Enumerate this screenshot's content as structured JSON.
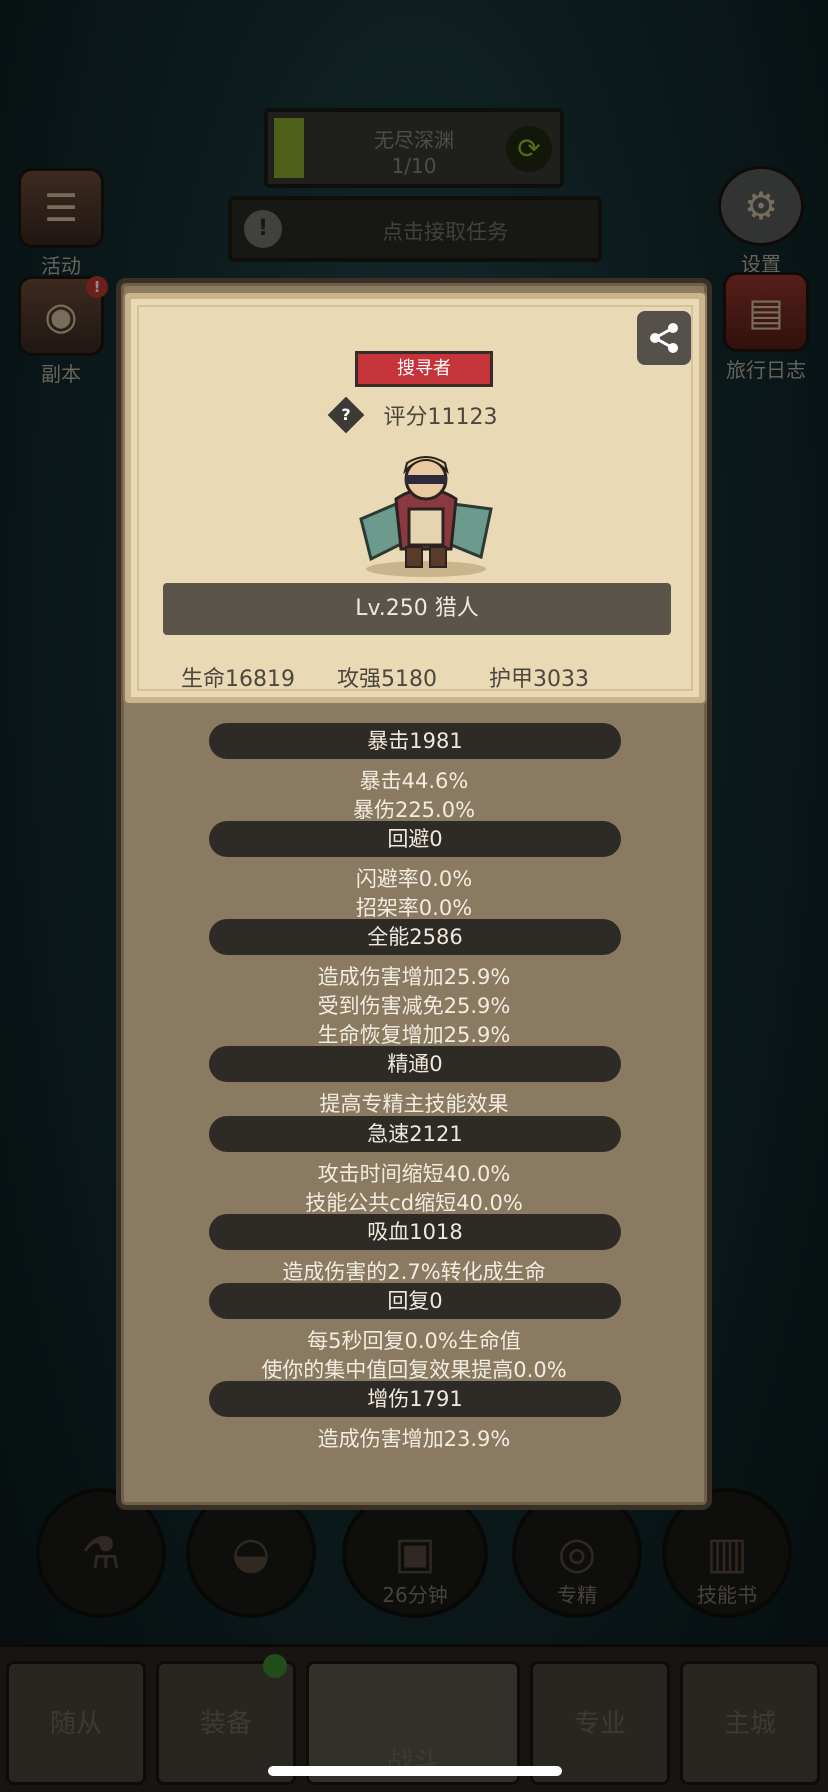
{
  "hud": {
    "dungeon_name": "无尽深渊",
    "dungeon_progress": "1/10",
    "task_label": "点击接取任务",
    "left_buttons": [
      {
        "label": "活动",
        "icon": "scroll-icon"
      },
      {
        "label": "副本",
        "icon": "portal-icon",
        "badge": "!"
      }
    ],
    "right_buttons": [
      {
        "label": "设置",
        "icon": "gear-icon"
      },
      {
        "label": "旅行日志",
        "icon": "book-icon"
      }
    ]
  },
  "modal": {
    "title_badge": "搜寻者",
    "score": "评分11123",
    "level_class": "Lv.250 猎人",
    "basic_stats": [
      "生命16819",
      "攻强5180",
      "护甲3033"
    ],
    "sections": [
      {
        "header": "暴击1981",
        "lines": [
          "暴击44.6%",
          "暴伤225.0%"
        ]
      },
      {
        "header": "回避0",
        "lines": [
          "闪避率0.0%",
          "招架率0.0%"
        ]
      },
      {
        "header": "全能2586",
        "lines": [
          "造成伤害增加25.9%",
          "受到伤害减免25.9%",
          "生命恢复增加25.9%"
        ]
      },
      {
        "header": "精通0",
        "lines": [
          "提高专精主技能效果"
        ]
      },
      {
        "header": "急速2121",
        "lines": [
          "攻击时间缩短40.0%",
          "技能公共cd缩短40.0%"
        ]
      },
      {
        "header": "吸血1018",
        "lines": [
          "造成伤害的2.7%转化成生命"
        ]
      },
      {
        "header": "回复0",
        "lines": [
          "每5秒回复0.0%生命值",
          "使你的集中值回复效果提高0.0%"
        ]
      },
      {
        "header": "增伤1791",
        "lines": [
          "造成伤害增加23.9%"
        ]
      }
    ]
  },
  "skills": {
    "timer": "26分钟",
    "spec_label": "专精",
    "skillbook_label": "技能书"
  },
  "bottom_tabs": [
    "随从",
    "装备",
    "战斗",
    "专业",
    "主城"
  ],
  "colors": {
    "badge_red": "#c5333b",
    "parchment": "#e9d9b5",
    "modal_bg": "#8a7a62",
    "stat_header_bg": "#2e2a26"
  }
}
